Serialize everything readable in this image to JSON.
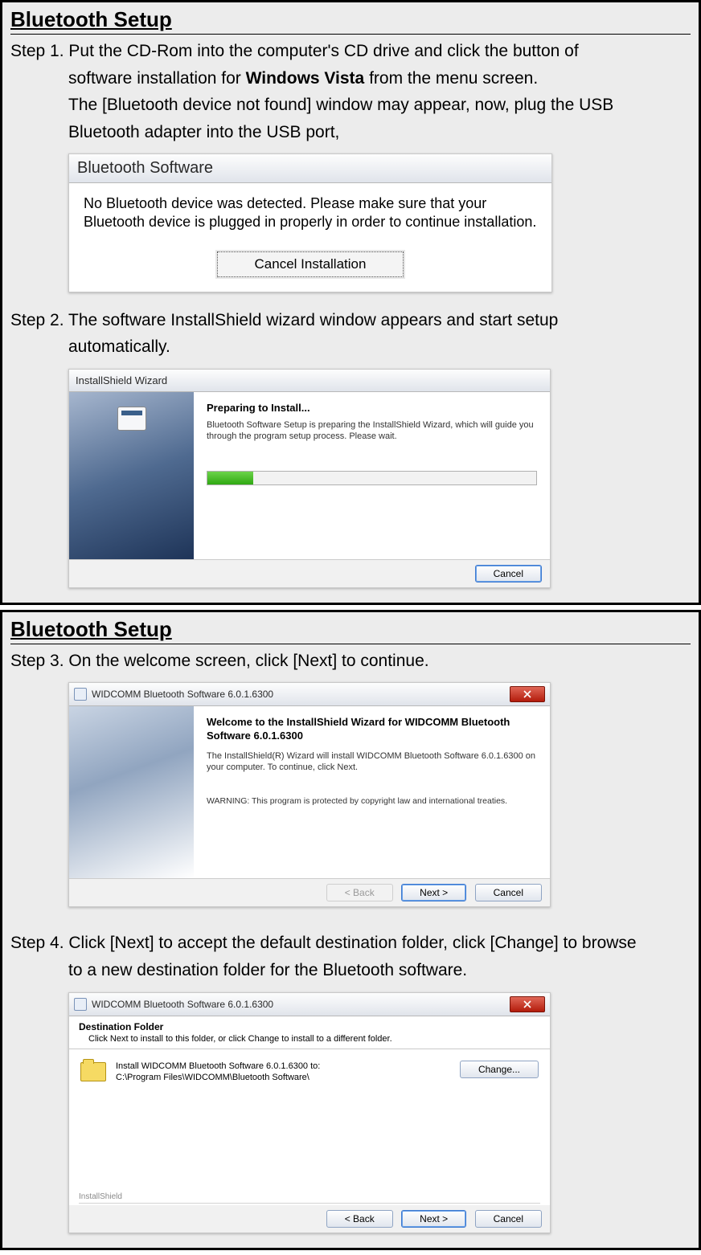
{
  "section1": {
    "title": "Bluetooth Setup",
    "step1": {
      "line1": "Step 1. Put the CD-Rom into the computer's CD drive and click the button of",
      "line2_pre": "software installation for ",
      "line2_bold": "Windows Vista",
      "line2_post": " from the menu screen.",
      "line3": "The [Bluetooth device not found] window may appear, now, plug the USB",
      "line4": "Bluetooth adapter into the USB port,"
    },
    "shot1": {
      "title": "Bluetooth Software",
      "body": "No Bluetooth device was detected. Please make sure that your Bluetooth device is plugged in properly in order to continue installation.",
      "button": "Cancel Installation"
    },
    "step2": {
      "line1": "Step 2. The software InstallShield wizard window appears and start setup",
      "line2": "automatically."
    },
    "shot2": {
      "title": "InstallShield Wizard",
      "heading": "Preparing to Install...",
      "body": "Bluetooth Software Setup is preparing the InstallShield Wizard, which will guide you through the program setup process.  Please wait.",
      "cancel": "Cancel"
    }
  },
  "section2": {
    "title": "Bluetooth Setup",
    "step3": "Step 3. On the welcome screen, click [Next] to continue.",
    "shot3": {
      "title": "WIDCOMM Bluetooth Software 6.0.1.6300",
      "heading": "Welcome to the InstallShield Wizard for WIDCOMM Bluetooth Software 6.0.1.6300",
      "body": "The InstallShield(R) Wizard will install WIDCOMM Bluetooth Software 6.0.1.6300   on your computer. To continue, click Next.",
      "warning": "WARNING: This program is protected by copyright law and international treaties.",
      "back": "< Back",
      "next": "Next >",
      "cancel": "Cancel"
    },
    "step4": {
      "line1": "Step 4. Click [Next] to accept the default destination folder, click [Change] to browse",
      "line2": "to a new destination folder for the Bluetooth software."
    },
    "shot4": {
      "title": "WIDCOMM Bluetooth Software 6.0.1.6300",
      "heading": "Destination Folder",
      "sub": "Click Next to install to this folder, or click Change to install to a different folder.",
      "installTo": "Install WIDCOMM Bluetooth Software 6.0.1.6300   to:",
      "path": "C:\\Program Files\\WIDCOMM\\Bluetooth Software\\",
      "change": "Change...",
      "installshield": "InstallShield",
      "back": "< Back",
      "next": "Next >",
      "cancel": "Cancel"
    }
  }
}
